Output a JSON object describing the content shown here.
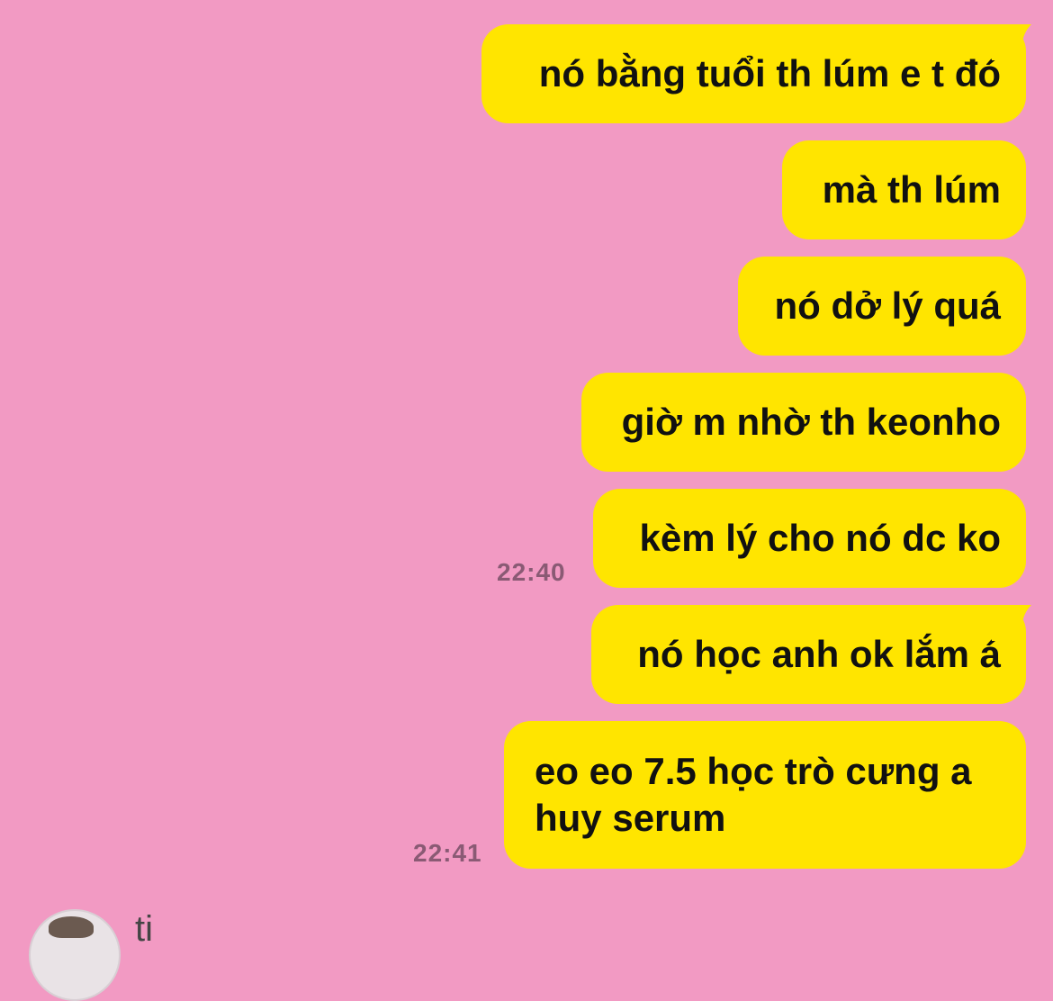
{
  "messages": [
    {
      "text": "nó bằng tuổi th lúm e t đó"
    },
    {
      "text": "mà th lúm"
    },
    {
      "text": "nó dở lý quá"
    },
    {
      "text": "giờ m nhờ th keonho"
    },
    {
      "text": "kèm lý cho nó dc ko",
      "time": "22:40"
    },
    {
      "text": "nó học anh ok lắm á"
    },
    {
      "text": "eo eo 7.5 học trò cưng a huy serum",
      "time": "22:41"
    }
  ],
  "next_sender": {
    "name_partial": "ti"
  },
  "colors": {
    "background": "#f29ac3",
    "bubble": "#ffe500",
    "timestamp": "#8a5a74"
  }
}
